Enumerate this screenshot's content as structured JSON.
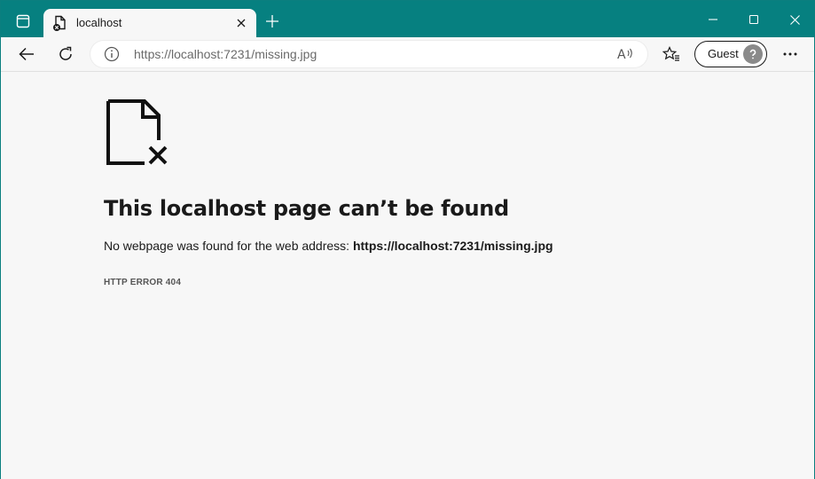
{
  "browser": {
    "tab": {
      "title": "localhost"
    },
    "address_bar": {
      "url": "https://localhost:7231/missing.jpg"
    },
    "profile": {
      "label": "Guest"
    },
    "colors": {
      "accent": "#068080"
    }
  },
  "error_page": {
    "title": "This localhost page can’t be found",
    "description_prefix": "No webpage was found for the web address:",
    "description_url": "https://localhost:7231/missing.jpg",
    "error_code": "HTTP ERROR 404"
  }
}
